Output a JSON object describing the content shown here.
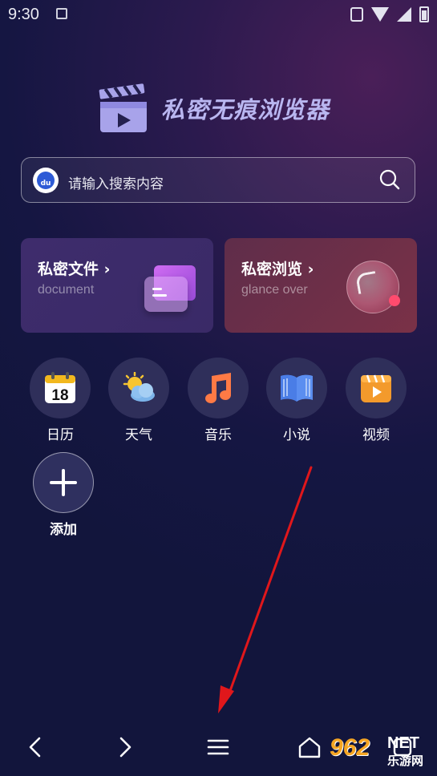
{
  "status_bar": {
    "time": "9:30"
  },
  "brand": {
    "title": "私密无痕浏览器",
    "logo_icon": "clapperboard-play-icon"
  },
  "search": {
    "engine_icon": "baidu-paw-icon",
    "engine_text": "du",
    "placeholder": "请输入搜索内容",
    "search_icon": "magnifier-icon"
  },
  "cards": [
    {
      "title": "私密文件",
      "subtitle": "document",
      "icon": "folder-icon"
    },
    {
      "title": "私密浏览",
      "subtitle": "glance over",
      "icon": "glass-orb-icon"
    }
  ],
  "apps": [
    {
      "label": "日历",
      "icon": "calendar-icon",
      "calendar_day": "18"
    },
    {
      "label": "天气",
      "icon": "weather-icon"
    },
    {
      "label": "音乐",
      "icon": "music-note-icon"
    },
    {
      "label": "小说",
      "icon": "book-icon"
    },
    {
      "label": "视频",
      "icon": "video-icon"
    },
    {
      "label": "添加",
      "icon": "plus-icon"
    }
  ],
  "nav": {
    "items": [
      "back-icon",
      "forward-icon",
      "menu-icon",
      "home-icon",
      "tabs-icon"
    ]
  },
  "watermark": {
    "number": "962",
    "net": "NET",
    "cn": "乐游网"
  },
  "colors": {
    "accent_text": "#b9b6f0",
    "arrow": "#e0171b",
    "watermark": "#f6a623"
  }
}
